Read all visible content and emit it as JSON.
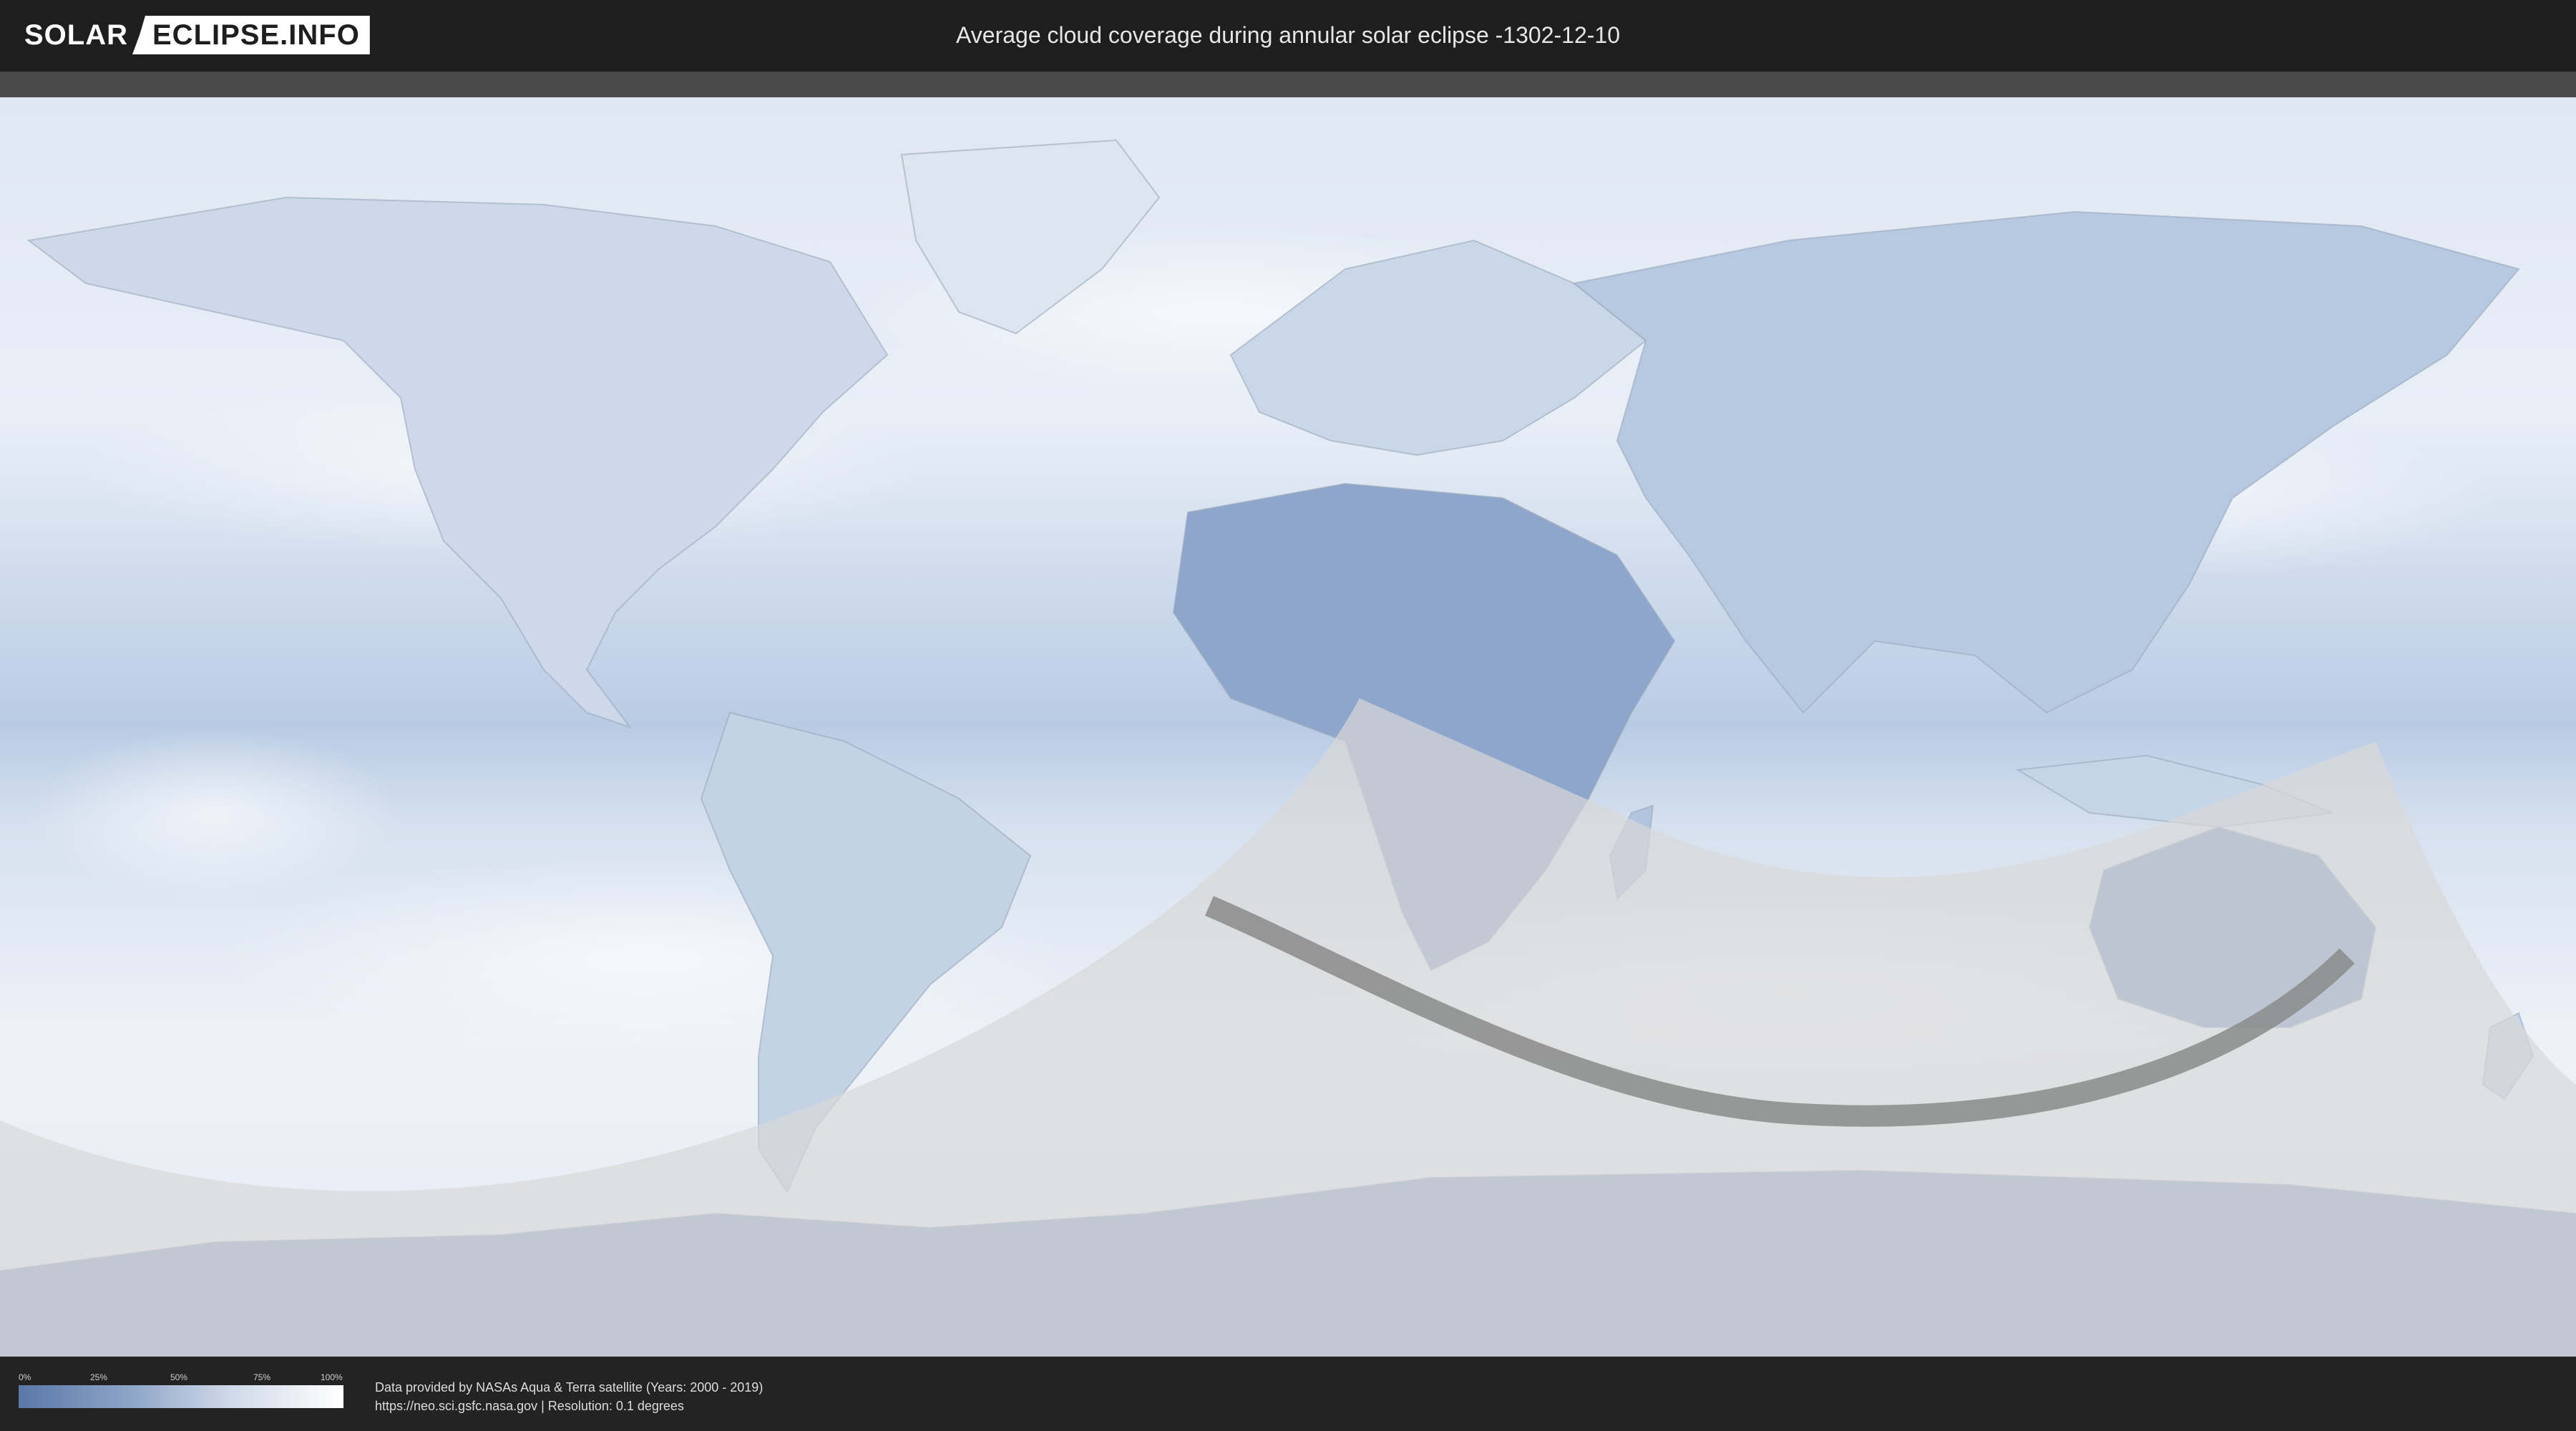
{
  "header": {
    "logo_left": "SOLAR",
    "logo_right": "ECLIPSE.INFO",
    "title": "Average cloud coverage during annular solar eclipse -1302-12-10"
  },
  "legend": {
    "ticks": [
      "0%",
      "25%",
      "50%",
      "75%",
      "100%"
    ],
    "colors": [
      "#5a77a8",
      "#ffffff"
    ]
  },
  "footer": {
    "credit_line1": "Data provided by NASAs Aqua & Terra satellite (Years: 2000 - 2019)",
    "credit_line2": "https://neo.sci.gsfc.nasa.gov | Resolution: 0.1 degrees"
  },
  "colors": {
    "ocean_cloud": "#c9d6e8",
    "land_clear": "#5f7fb0",
    "shadow_overlay": "#d8d8d8",
    "path_band": "#8a8a8a"
  }
}
